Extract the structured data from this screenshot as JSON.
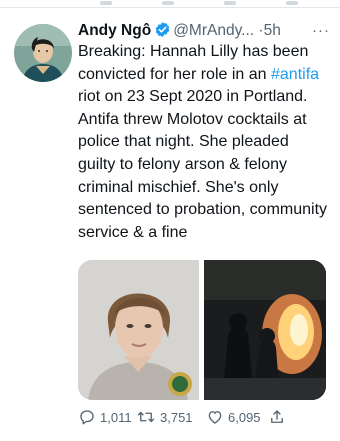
{
  "tweet": {
    "display_name": "Andy Ngô",
    "handle": "@MrAndy...",
    "separator": "·",
    "time": "5h",
    "more": "···",
    "text_before": "Breaking: Hannah Lilly has been convicted for her role in an ",
    "hashtag": "#antifa",
    "text_after": " riot on 23 Sept 2020 in Portland. Antifa threw Molotov cocktails at police that night. She pleaded guilty to felony arson & felony criminal mischief. She's only sentenced to probation, community service & a fine"
  },
  "actions": {
    "replies": "1,011",
    "retweets": "3,751",
    "likes": "6,095"
  },
  "colors": {
    "accent": "#1d9bf0",
    "text": "#0f1419",
    "secondary": "#536471"
  },
  "icons": [
    "verified-badge-icon",
    "more-icon",
    "reply-icon",
    "retweet-icon",
    "like-icon",
    "share-icon"
  ]
}
